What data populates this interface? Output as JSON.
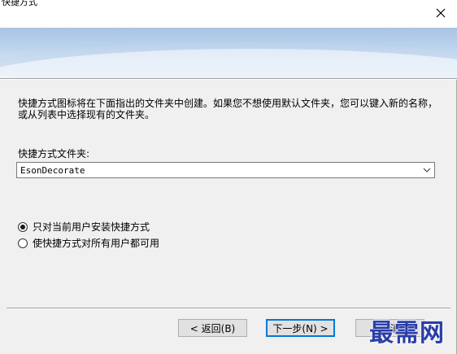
{
  "window": {
    "title": "快捷方式"
  },
  "description": "快捷方式图标将在下面指出的文件夹中创建。如果您不想使用默认文件夹，您可以键入新的名称，或从列表中选择现有的文件夹。",
  "folder": {
    "label": "快捷方式文件夹:",
    "value": "EsonDecorate"
  },
  "options": [
    {
      "label": "只对当前用户安装快捷方式",
      "selected": true
    },
    {
      "label": "使快捷方式对所有用户都可用",
      "selected": false
    }
  ],
  "buttons": {
    "back": "< 返回(B)",
    "next": "下一步(N) >",
    "cancel": "取消"
  },
  "watermark": "最需网",
  "colors": {
    "banner_top": "#a8c4e4",
    "banner_bottom": "#e6eef8",
    "dialog_bg": "#f0f0f0",
    "primary_border": "#0078d7",
    "watermark": "#2a3ea8"
  },
  "icons": {
    "close": "close-icon",
    "dropdown": "chevron-down-icon"
  }
}
